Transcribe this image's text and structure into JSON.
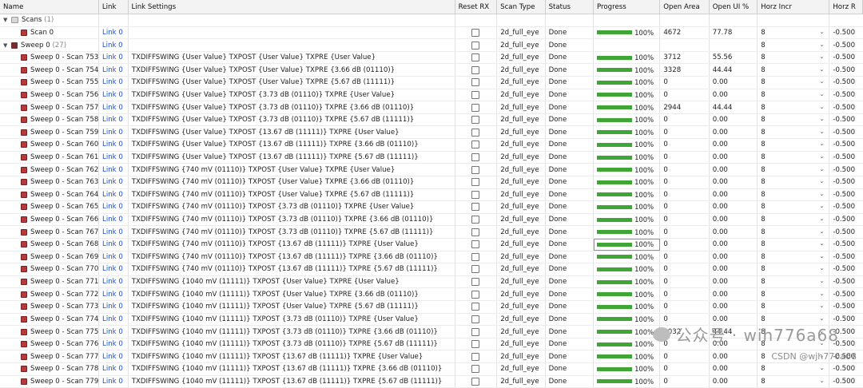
{
  "columns": {
    "name": "Name",
    "link": "Link",
    "settings": "Link Settings",
    "reset": "Reset RX",
    "type": "Scan Type",
    "status": "Status",
    "progress": "Progress",
    "area": "Open Area",
    "ui": "Open UI %",
    "horz": "Horz Incr",
    "last": "Horz R"
  },
  "scans_group": {
    "label": "Scans",
    "count": "(1)"
  },
  "scan0": {
    "name": "Scan 0",
    "link": "Link 0",
    "type": "2d_full_eye",
    "status": "Done",
    "progress": "100%",
    "area": "4672",
    "ui": "77.78",
    "horz": "8",
    "last": "-0.500"
  },
  "sweep_group": {
    "label": "Sweep 0",
    "count": "(27)",
    "link": "Link 0",
    "type": "2d_full_eye",
    "status": "Done",
    "horz": "8",
    "last": "-0.500"
  },
  "progress_value": 1.0,
  "accent_color": "#3fa535",
  "link_color": "#1a4fd8",
  "rows": [
    {
      "name": "Sweep 0 - Scan 753",
      "link": "Link 0",
      "settings": "TXDIFFSWING {User Value} TXPOST {User Value} TXPRE {User Value}",
      "type": "2d_full_eye",
      "status": "Done",
      "progress": "100%",
      "area": "3712",
      "ui": "55.56",
      "horz": "8",
      "last": "-0.500"
    },
    {
      "name": "Sweep 0 - Scan 754",
      "link": "Link 0",
      "settings": "TXDIFFSWING {User Value} TXPOST {User Value} TXPRE {3.66 dB (01110)}",
      "type": "2d_full_eye",
      "status": "Done",
      "progress": "100%",
      "area": "3328",
      "ui": "44.44",
      "horz": "8",
      "last": "-0.500"
    },
    {
      "name": "Sweep 0 - Scan 755",
      "link": "Link 0",
      "settings": "TXDIFFSWING {User Value} TXPOST {User Value} TXPRE {5.67 dB (11111)}",
      "type": "2d_full_eye",
      "status": "Done",
      "progress": "100%",
      "area": "0",
      "ui": "0.00",
      "horz": "8",
      "last": "-0.500"
    },
    {
      "name": "Sweep 0 - Scan 756",
      "link": "Link 0",
      "settings": "TXDIFFSWING {User Value} TXPOST {3.73 dB (01110)} TXPRE {User Value}",
      "type": "2d_full_eye",
      "status": "Done",
      "progress": "100%",
      "area": "0",
      "ui": "0.00",
      "horz": "8",
      "last": "-0.500"
    },
    {
      "name": "Sweep 0 - Scan 757",
      "link": "Link 0",
      "settings": "TXDIFFSWING {User Value} TXPOST {3.73 dB (01110)} TXPRE {3.66 dB (01110)}",
      "type": "2d_full_eye",
      "status": "Done",
      "progress": "100%",
      "area": "2944",
      "ui": "44.44",
      "horz": "8",
      "last": "-0.500"
    },
    {
      "name": "Sweep 0 - Scan 758",
      "link": "Link 0",
      "settings": "TXDIFFSWING {User Value} TXPOST {3.73 dB (01110)} TXPRE {5.67 dB (11111)}",
      "type": "2d_full_eye",
      "status": "Done",
      "progress": "100%",
      "area": "0",
      "ui": "0.00",
      "horz": "8",
      "last": "-0.500"
    },
    {
      "name": "Sweep 0 - Scan 759",
      "link": "Link 0",
      "settings": "TXDIFFSWING {User Value} TXPOST {13.67 dB (11111)} TXPRE {User Value}",
      "type": "2d_full_eye",
      "status": "Done",
      "progress": "100%",
      "area": "0",
      "ui": "0.00",
      "horz": "8",
      "last": "-0.500"
    },
    {
      "name": "Sweep 0 - Scan 760",
      "link": "Link 0",
      "settings": "TXDIFFSWING {User Value} TXPOST {13.67 dB (11111)} TXPRE {3.66 dB (01110)}",
      "type": "2d_full_eye",
      "status": "Done",
      "progress": "100%",
      "area": "0",
      "ui": "0.00",
      "horz": "8",
      "last": "-0.500"
    },
    {
      "name": "Sweep 0 - Scan 761",
      "link": "Link 0",
      "settings": "TXDIFFSWING {User Value} TXPOST {13.67 dB (11111)} TXPRE {5.67 dB (11111)}",
      "type": "2d_full_eye",
      "status": "Done",
      "progress": "100%",
      "area": "0",
      "ui": "0.00",
      "horz": "8",
      "last": "-0.500"
    },
    {
      "name": "Sweep 0 - Scan 762",
      "link": "Link 0",
      "settings": "TXDIFFSWING {740 mV (01110)} TXPOST {User Value} TXPRE {User Value}",
      "type": "2d_full_eye",
      "status": "Done",
      "progress": "100%",
      "area": "0",
      "ui": "0.00",
      "horz": "8",
      "last": "-0.500"
    },
    {
      "name": "Sweep 0 - Scan 763",
      "link": "Link 0",
      "settings": "TXDIFFSWING {740 mV (01110)} TXPOST {User Value} TXPRE {3.66 dB (01110)}",
      "type": "2d_full_eye",
      "status": "Done",
      "progress": "100%",
      "area": "0",
      "ui": "0.00",
      "horz": "8",
      "last": "-0.500"
    },
    {
      "name": "Sweep 0 - Scan 764",
      "link": "Link 0",
      "settings": "TXDIFFSWING {740 mV (01110)} TXPOST {User Value} TXPRE {5.67 dB (11111)}",
      "type": "2d_full_eye",
      "status": "Done",
      "progress": "100%",
      "area": "0",
      "ui": "0.00",
      "horz": "8",
      "last": "-0.500"
    },
    {
      "name": "Sweep 0 - Scan 765",
      "link": "Link 0",
      "settings": "TXDIFFSWING {740 mV (01110)} TXPOST {3.73 dB (01110)} TXPRE {User Value}",
      "type": "2d_full_eye",
      "status": "Done",
      "progress": "100%",
      "area": "0",
      "ui": "0.00",
      "horz": "8",
      "last": "-0.500"
    },
    {
      "name": "Sweep 0 - Scan 766",
      "link": "Link 0",
      "settings": "TXDIFFSWING {740 mV (01110)} TXPOST {3.73 dB (01110)} TXPRE {3.66 dB (01110)}",
      "type": "2d_full_eye",
      "status": "Done",
      "progress": "100%",
      "area": "0",
      "ui": "0.00",
      "horz": "8",
      "last": "-0.500"
    },
    {
      "name": "Sweep 0 - Scan 767",
      "link": "Link 0",
      "settings": "TXDIFFSWING {740 mV (01110)} TXPOST {3.73 dB (01110)} TXPRE {5.67 dB (11111)}",
      "type": "2d_full_eye",
      "status": "Done",
      "progress": "100%",
      "area": "0",
      "ui": "0.00",
      "horz": "8",
      "last": "-0.500"
    },
    {
      "name": "Sweep 0 - Scan 768",
      "link": "Link 0",
      "settings": "TXDIFFSWING {740 mV (01110)} TXPOST {13.67 dB (11111)} TXPRE {User Value}",
      "type": "2d_full_eye",
      "status": "Done",
      "progress": "100%",
      "area": "0",
      "ui": "0.00",
      "horz": "8",
      "last": "-0.500",
      "selected": true
    },
    {
      "name": "Sweep 0 - Scan 769",
      "link": "Link 0",
      "settings": "TXDIFFSWING {740 mV (01110)} TXPOST {13.67 dB (11111)} TXPRE {3.66 dB (01110)}",
      "type": "2d_full_eye",
      "status": "Done",
      "progress": "100%",
      "area": "0",
      "ui": "0.00",
      "horz": "8",
      "last": "-0.500"
    },
    {
      "name": "Sweep 0 - Scan 770",
      "link": "Link 0",
      "settings": "TXDIFFSWING {740 mV (01110)} TXPOST {13.67 dB (11111)} TXPRE {5.67 dB (11111)}",
      "type": "2d_full_eye",
      "status": "Done",
      "progress": "100%",
      "area": "0",
      "ui": "0.00",
      "horz": "8",
      "last": "-0.500"
    },
    {
      "name": "Sweep 0 - Scan 771",
      "link": "Link 0",
      "settings": "TXDIFFSWING {1040 mV (11111)} TXPOST {User Value} TXPRE {User Value}",
      "type": "2d_full_eye",
      "status": "Done",
      "progress": "100%",
      "area": "0",
      "ui": "0.00",
      "horz": "8",
      "last": "-0.500"
    },
    {
      "name": "Sweep 0 - Scan 772",
      "link": "Link 0",
      "settings": "TXDIFFSWING {1040 mV (11111)} TXPOST {User Value} TXPRE {3.66 dB (01110)}",
      "type": "2d_full_eye",
      "status": "Done",
      "progress": "100%",
      "area": "0",
      "ui": "0.00",
      "horz": "8",
      "last": "-0.500"
    },
    {
      "name": "Sweep 0 - Scan 773",
      "link": "Link 0",
      "settings": "TXDIFFSWING {1040 mV (11111)} TXPOST {User Value} TXPRE {5.67 dB (11111)}",
      "type": "2d_full_eye",
      "status": "Done",
      "progress": "100%",
      "area": "0",
      "ui": "0.00",
      "horz": "8",
      "last": "-0.500"
    },
    {
      "name": "Sweep 0 - Scan 774",
      "link": "Link 0",
      "settings": "TXDIFFSWING {1040 mV (11111)} TXPOST {3.73 dB (01110)} TXPRE {User Value}",
      "type": "2d_full_eye",
      "status": "Done",
      "progress": "100%",
      "area": "0",
      "ui": "0.00",
      "horz": "8",
      "last": "-0.500"
    },
    {
      "name": "Sweep 0 - Scan 775",
      "link": "Link 0",
      "settings": "TXDIFFSWING {1040 mV (11111)} TXPOST {3.73 dB (01110)} TXPRE {3.66 dB (01110)}",
      "type": "2d_full_eye",
      "status": "Done",
      "progress": "100%",
      "area": "4032",
      "ui": "44.44",
      "horz": "8",
      "last": "-0.500"
    },
    {
      "name": "Sweep 0 - Scan 776",
      "link": "Link 0",
      "settings": "TXDIFFSWING {1040 mV (11111)} TXPOST {3.73 dB (01110)} TXPRE {5.67 dB (11111)}",
      "type": "2d_full_eye",
      "status": "Done",
      "progress": "100%",
      "area": "0",
      "ui": "0.00",
      "horz": "8",
      "last": "-0.500"
    },
    {
      "name": "Sweep 0 - Scan 777",
      "link": "Link 0",
      "settings": "TXDIFFSWING {1040 mV (11111)} TXPOST {13.67 dB (11111)} TXPRE {User Value}",
      "type": "2d_full_eye",
      "status": "Done",
      "progress": "100%",
      "area": "0",
      "ui": "0.00",
      "horz": "8",
      "last": "-0.500"
    },
    {
      "name": "Sweep 0 - Scan 778",
      "link": "Link 0",
      "settings": "TXDIFFSWING {1040 mV (11111)} TXPOST {13.67 dB (11111)} TXPRE {3.66 dB (01110)}",
      "type": "2d_full_eye",
      "status": "Done",
      "progress": "100%",
      "area": "0",
      "ui": "0.00",
      "horz": "8",
      "last": "-0.500"
    },
    {
      "name": "Sweep 0 - Scan 779",
      "link": "Link 0",
      "settings": "TXDIFFSWING {1040 mV (11111)} TXPOST {13.67 dB (11111)} TXPRE {5.67 dB (11111)}",
      "type": "2d_full_eye",
      "status": "Done",
      "progress": "100%",
      "area": "0",
      "ui": "0.00",
      "horz": "8",
      "last": "-0.500"
    }
  ],
  "watermark": "公众号 · wih776a68",
  "csdn": "CSDN @wjh776a68"
}
